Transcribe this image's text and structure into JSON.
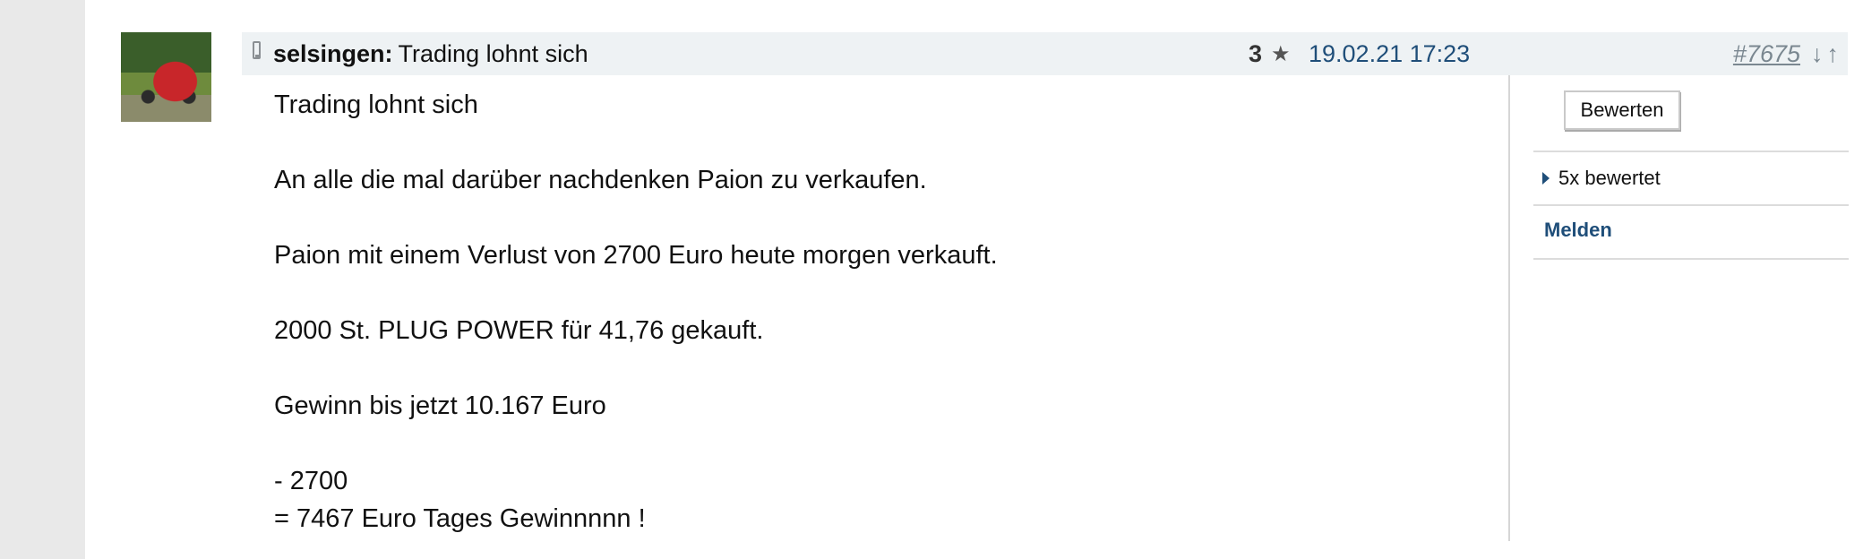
{
  "post": {
    "author": "selsingen:",
    "title": "Trading lohnt sich",
    "rating_count": "3",
    "rating_icon": "star-icon",
    "date": "19.02.21 17:23",
    "number": "#7675",
    "down_arrow": "↓",
    "up_arrow": "↑"
  },
  "body": {
    "lines": [
      "Trading lohnt sich",
      "",
      "An alle die mal darüber nachdenken Paion zu verkaufen.",
      "",
      "Paion mit einem Verlust von 2700 Euro heute morgen verkauft.",
      "",
      "2000 St. PLUG POWER für 41,76 gekauft.",
      "",
      "Gewinn bis jetzt 10.167 Euro",
      "",
      "- 2700",
      "= 7467 Euro Tages Gewinnnnn !"
    ]
  },
  "sidebar": {
    "rate_button": "Bewerten",
    "ratings_toggle": "5x bewertet",
    "report_link": "Melden"
  },
  "colors": {
    "link": "#1f4e79",
    "header_bg": "#eef2f4"
  }
}
